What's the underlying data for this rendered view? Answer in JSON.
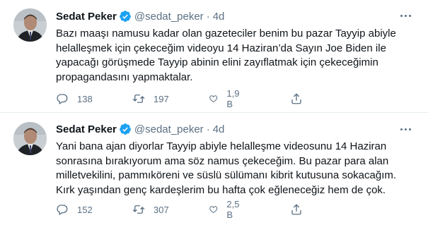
{
  "tweets": [
    {
      "author": {
        "name": "Sedat Peker",
        "handle": "@sedat_peker",
        "separator": "·",
        "time": "4d",
        "verified_icon": "verified-badge-icon"
      },
      "text_lines": [
        "Bazı maaşı namusu kadar olan gazeteciler benim bu pazar Tayyip abiyle",
        "helalleşmek için çekeceğim videoyu 14 Haziran’da Sayın Joe Biden ile",
        "yapacağı görüşmede Tayyip abinin elini zayıflatmak için çekeceğimin",
        "propagandasını yapmaktalar."
      ],
      "actions": {
        "replies": "138",
        "retweets": "197",
        "likes": "1,9 B"
      }
    },
    {
      "author": {
        "name": "Sedat Peker",
        "handle": "@sedat_peker",
        "separator": "·",
        "time": "4d",
        "verified_icon": "verified-badge-icon"
      },
      "text_lines": [
        "Yani bana ajan diyorlar Tayyip abiyle helalleşme videosunu 14 Haziran",
        "sonrasına bırakıyorum ama söz namus çekeceğim. Bu pazar para alan",
        "milletvekilini, pammıköreni ve süslü sülümanı kibrit kutusuna sokacağım.",
        "Kırk yaşından genç kardeşlerim bu hafta çok eğleneceğiz hem de çok."
      ],
      "actions": {
        "replies": "152",
        "retweets": "307",
        "likes": "2,5 B"
      }
    }
  ],
  "colors": {
    "accent": "#1da1f2",
    "muted": "#5b7083",
    "text": "#0f1419",
    "divider": "#e6ecf0"
  }
}
